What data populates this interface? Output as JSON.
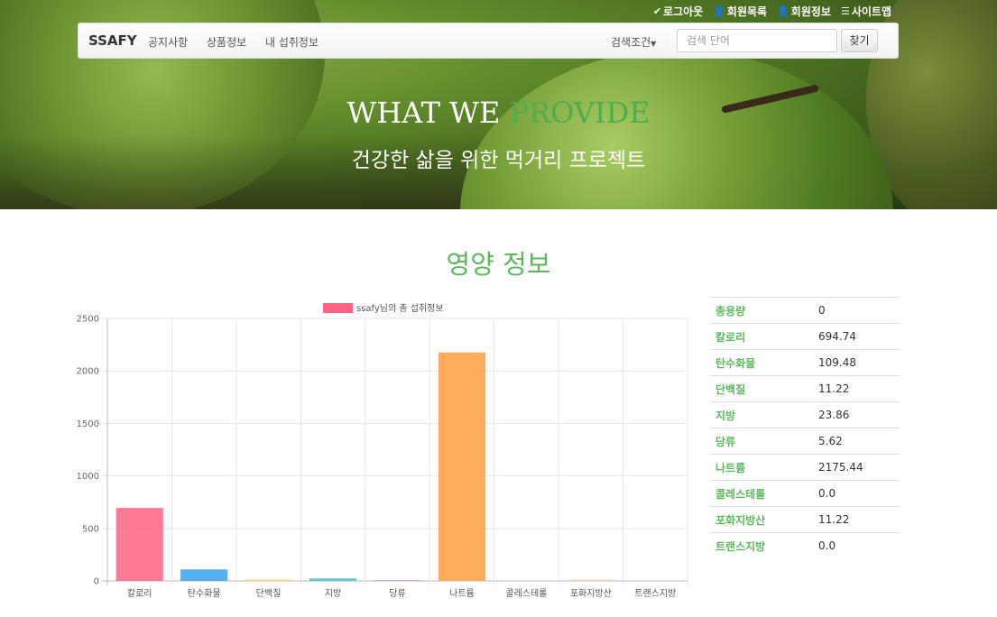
{
  "top_links": [
    {
      "icon": "check-icon",
      "label": "로그아웃"
    },
    {
      "icon": "user-icon",
      "label": "회원목록"
    },
    {
      "icon": "user-icon",
      "label": "회원정보"
    },
    {
      "icon": "list-icon",
      "label": "사이트맵"
    }
  ],
  "navbar": {
    "brand": "SSAFY",
    "items": [
      "공지사항",
      "상품정보",
      "내 섭취정보"
    ],
    "dropdown_label": "검색조건",
    "search_placeholder": "검색 단어",
    "search_button": "찾기"
  },
  "hero": {
    "title_main": "WHAT WE ",
    "title_accent": "PROVIDE",
    "subtitle": "건강한 삶을 위한 먹거리 프로젝트"
  },
  "section_title": "영양 정보",
  "colors": {
    "accent_green": "#5cb85c",
    "bar_colors": [
      "#ff6384",
      "#36a2eb",
      "#ffce56",
      "#4bc0c0",
      "#9966ff",
      "#ff9f40",
      "#ff6384",
      "#ffcd9f",
      "#c9cbcf"
    ]
  },
  "chart_data": {
    "type": "bar",
    "legend": "ssafy님의 총 섭취정보",
    "legend_position": "top",
    "categories": [
      "칼로리",
      "탄수화물",
      "단백질",
      "지방",
      "당류",
      "나트륨",
      "콜레스테롤",
      "포화지방산",
      "트랜스지방"
    ],
    "values": [
      694.74,
      109.48,
      11.22,
      23.86,
      5.62,
      2175.44,
      0.0,
      11.22,
      0.0
    ],
    "ylim": [
      0,
      2500
    ],
    "yticks": [
      0,
      500,
      1000,
      1500,
      2000,
      2500
    ],
    "grid": true
  },
  "table": [
    {
      "key": "총용량",
      "value": "0"
    },
    {
      "key": "칼로리",
      "value": "694.74"
    },
    {
      "key": "탄수화물",
      "value": "109.48"
    },
    {
      "key": "단백질",
      "value": "11.22"
    },
    {
      "key": "지방",
      "value": "23.86"
    },
    {
      "key": "당류",
      "value": "5.62"
    },
    {
      "key": "나트륨",
      "value": "2175.44"
    },
    {
      "key": "콜레스테롤",
      "value": "0.0"
    },
    {
      "key": "포화지방산",
      "value": "11.22"
    },
    {
      "key": "트랜스지방",
      "value": "0.0"
    }
  ]
}
